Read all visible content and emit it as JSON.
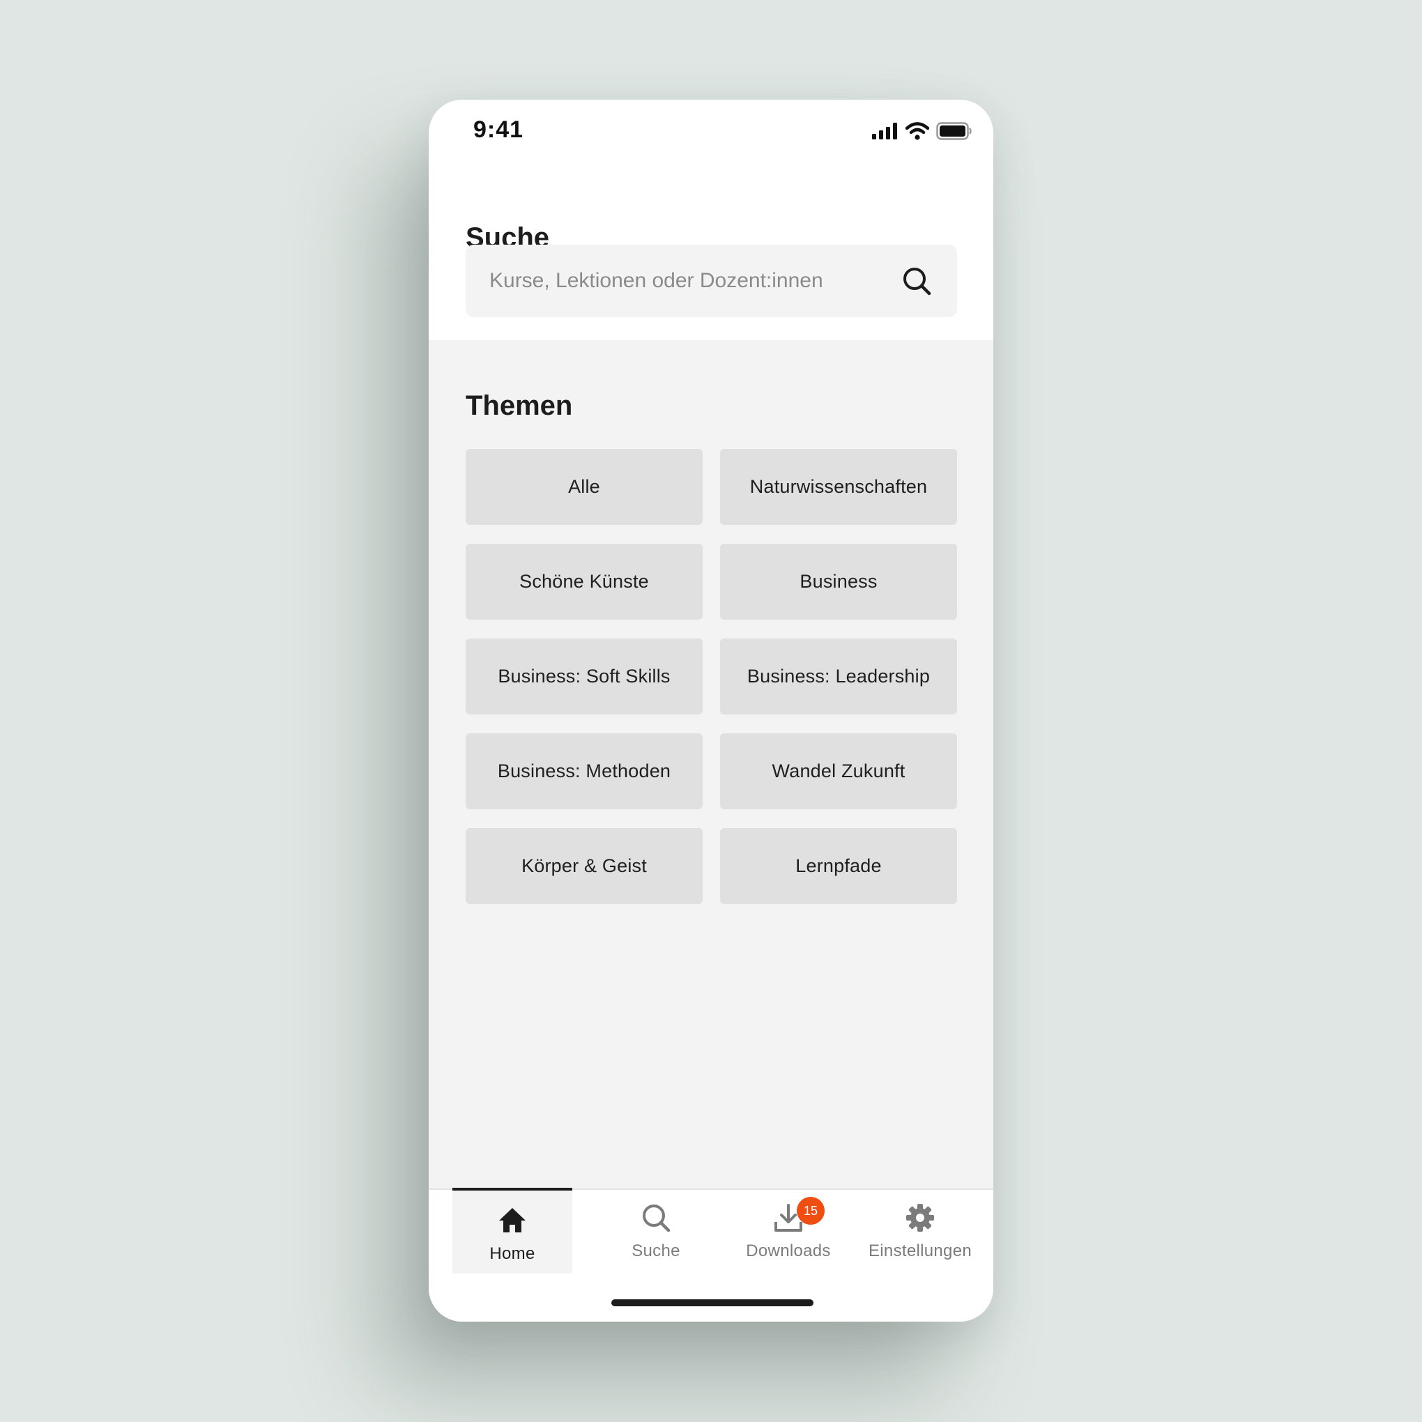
{
  "status_bar": {
    "time": "9:41"
  },
  "header": {
    "title": "Suche"
  },
  "search": {
    "placeholder": "Kurse, Lektionen oder Dozent:innen"
  },
  "topics": {
    "title": "Themen",
    "items": [
      {
        "label": "Alle"
      },
      {
        "label": "Naturwissenschaften"
      },
      {
        "label": "Schöne Künste"
      },
      {
        "label": "Business"
      },
      {
        "label": "Business: Soft Skills"
      },
      {
        "label": "Business: Leadership"
      },
      {
        "label": "Business: Methoden"
      },
      {
        "label": "Wandel Zukunft"
      },
      {
        "label": "Körper & Geist"
      },
      {
        "label": "Lernpfade"
      }
    ]
  },
  "bottom_nav": {
    "items": [
      {
        "label": "Home",
        "icon": "home-icon",
        "active": true
      },
      {
        "label": "Suche",
        "icon": "search-icon",
        "active": false
      },
      {
        "label": "Downloads",
        "icon": "download-icon",
        "active": false,
        "badge": "15"
      },
      {
        "label": "Einstellungen",
        "icon": "gear-icon",
        "active": false
      }
    ]
  },
  "colors": {
    "background": "#dfe6e3",
    "surface": "#ffffff",
    "content_background": "#f3f3f3",
    "card": "#e0e0e0",
    "text_primary": "#1d1d1d",
    "text_muted": "#7b7b7b",
    "badge": "#ef4d12"
  }
}
